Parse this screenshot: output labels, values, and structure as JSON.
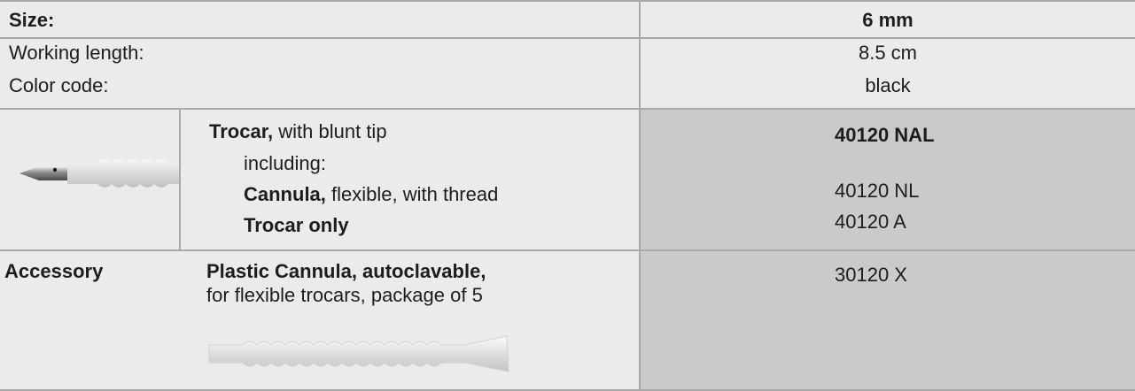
{
  "specs": {
    "size_label": "Size:",
    "size_value": "6 mm",
    "working_length_label": "Working length:",
    "working_length_value": "8.5 cm",
    "color_code_label": "Color code:",
    "color_code_value": "black"
  },
  "trocar_row": {
    "title": "Trocar,",
    "title_rest": " with blunt tip",
    "including": "including:",
    "cannula": "Cannula,",
    "cannula_rest": " flexible, with thread",
    "trocar_only": "Trocar only",
    "code_main": "40120 NAL",
    "code_cannula": "40120 NL",
    "code_trocar": "40120 A",
    "image_icon": "trocar-with-cannula-image"
  },
  "accessory_row": {
    "label": "Accessory",
    "title": "Plastic Cannula, autoclavable,",
    "desc": "for flexible trocars, package of 5",
    "code": "30120 X",
    "image_icon": "plastic-cannula-image"
  },
  "colors": {
    "light_bg": "#ebebeb",
    "dark_bg": "#cacaca",
    "rule": "#a9a9a9",
    "text": "#1d1d1b"
  }
}
